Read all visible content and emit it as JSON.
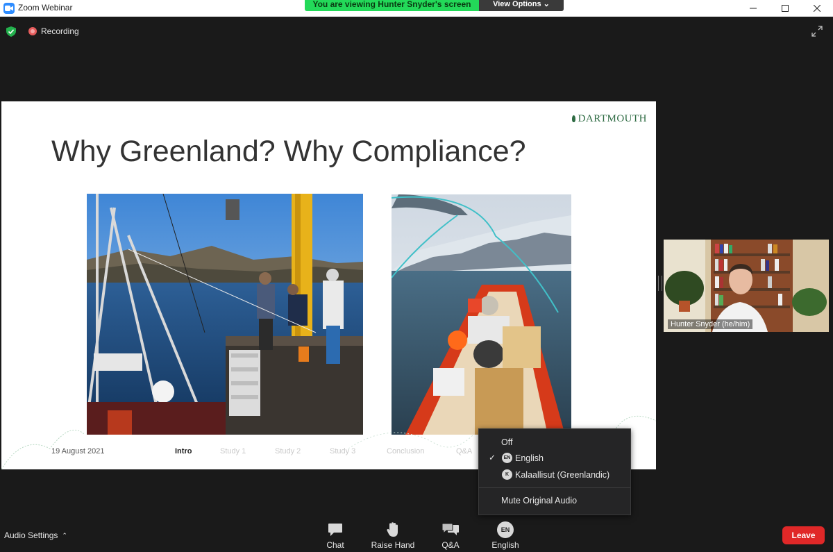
{
  "window": {
    "title": "Zoom Webinar"
  },
  "banner": {
    "viewing": "You are viewing Hunter Snyder's screen",
    "view_options": "View Options"
  },
  "status": {
    "recording": "Recording"
  },
  "slide": {
    "brand": "DARTMOUTH",
    "title": "Why Greenland? Why Compliance?",
    "date": "19 August 2021",
    "sections": [
      "Intro",
      "Study 1",
      "Study 2",
      "Study 3",
      "Conclusion",
      "Q&A"
    ],
    "active_section": "Intro"
  },
  "speaker": {
    "name": "Hunter Snyder (he/him)"
  },
  "language_menu": {
    "off": "Off",
    "items": [
      {
        "badge": "EN",
        "label": "English",
        "checked": true
      },
      {
        "badge": "K",
        "label": "Kalaallisut (Greenlandic)",
        "checked": false
      }
    ],
    "mute_original": "Mute Original Audio"
  },
  "toolbar": {
    "audio_settings": "Audio Settings",
    "chat": "Chat",
    "raise_hand": "Raise Hand",
    "qa": "Q&A",
    "language": "English",
    "language_badge": "EN",
    "leave": "Leave"
  },
  "colors": {
    "accent": "#2d8cff",
    "banner": "#23d959",
    "leave": "#e02828",
    "brand": "#2e6b43"
  }
}
